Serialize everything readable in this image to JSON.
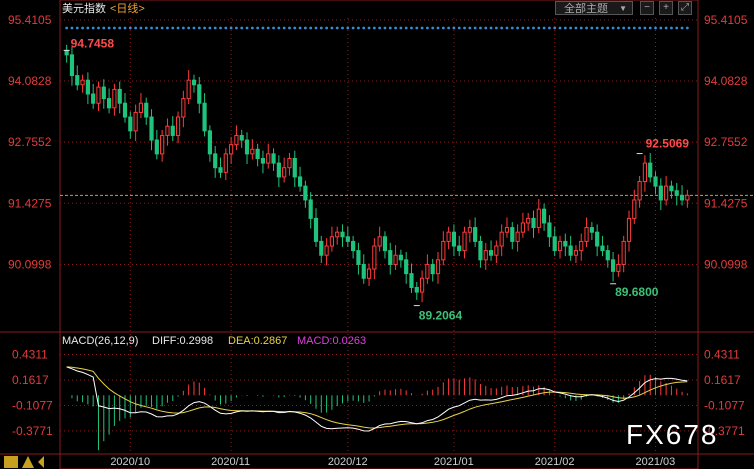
{
  "header": {
    "title": "美元指数",
    "period": "<日线>",
    "topic_select": "全部主题",
    "tool_icons": [
      "minus-icon",
      "plus-icon",
      "expand-icon"
    ]
  },
  "price_axis": {
    "ticks": [
      "95.4105",
      "94.0828",
      "92.7552",
      "91.4275",
      "90.0998"
    ],
    "tick_values": [
      95.4105,
      94.0828,
      92.7552,
      91.4275,
      90.0998
    ],
    "range": [
      88.72,
      95.45
    ],
    "current_line_value": 91.6
  },
  "highlights": {
    "high1": {
      "label": "94.7458",
      "value": 94.7458
    },
    "high2": {
      "label": "92.5069",
      "value": 92.5069
    },
    "low1": {
      "label": "89.2064",
      "value": 89.2064
    },
    "low2": {
      "label": "89.6800",
      "value": 89.68
    }
  },
  "macd": {
    "label": "MACD(26,12,9)",
    "diff": "DIFF:0.2998",
    "dea": "DEA:0.2867",
    "macd": "MACD:0.0263",
    "ticks": [
      "0.4311",
      "0.1617",
      "-0.1077",
      "-0.3771"
    ],
    "tick_values": [
      0.4311,
      0.1617,
      -0.1077,
      -0.3771
    ],
    "range": [
      -0.6,
      0.5
    ]
  },
  "dates": [
    "2020/10",
    "2020/11",
    "2020/12",
    "2021/01",
    "2021/02",
    "2021/03"
  ],
  "watermark": "FX678",
  "colors": {
    "up": "#ff3b3b",
    "down": "#1fc47c",
    "dea_line": "#e8d24a",
    "diff_line": "#ffffff",
    "grid": "#8a1a1a",
    "dots": "#3a8ad8",
    "current_line": "#e89040"
  },
  "chart_data": {
    "type": "candlestick",
    "series_note": "",
    "closes": [
      94.65,
      94.2,
      94.0,
      94.1,
      93.8,
      93.6,
      93.95,
      93.7,
      93.5,
      93.9,
      93.6,
      93.3,
      93.0,
      93.4,
      93.6,
      93.3,
      92.8,
      92.5,
      92.9,
      93.1,
      92.9,
      93.3,
      93.7,
      94.1,
      94.0,
      93.6,
      93.0,
      92.5,
      92.2,
      92.1,
      92.5,
      92.7,
      92.9,
      92.8,
      92.5,
      92.6,
      92.4,
      92.3,
      92.5,
      92.3,
      92.0,
      92.2,
      92.4,
      92.0,
      91.8,
      91.5,
      91.1,
      90.6,
      90.3,
      90.5,
      90.7,
      90.8,
      90.7,
      90.6,
      90.4,
      90.1,
      89.8,
      90.0,
      90.5,
      90.7,
      90.4,
      90.1,
      90.3,
      90.2,
      89.9,
      89.6,
      89.5,
      89.8,
      90.1,
      89.9,
      90.2,
      90.6,
      90.8,
      90.5,
      90.4,
      90.8,
      90.9,
      90.6,
      90.2,
      90.4,
      90.3,
      90.5,
      90.8,
      90.9,
      90.6,
      90.8,
      91.0,
      91.1,
      90.9,
      91.3,
      91.0,
      90.7,
      90.4,
      90.6,
      90.5,
      90.3,
      90.4,
      90.6,
      90.9,
      90.8,
      90.5,
      90.4,
      90.2,
      89.95,
      90.1,
      90.6,
      91.1,
      91.5,
      91.9,
      92.3,
      92.0,
      91.8,
      91.5,
      91.8,
      91.7,
      91.6,
      91.5,
      91.6
    ]
  }
}
